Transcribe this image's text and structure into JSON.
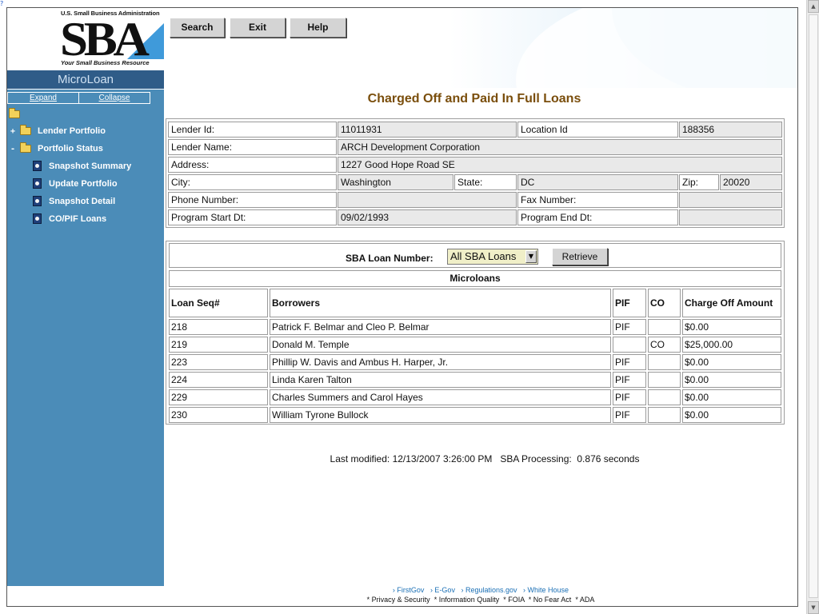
{
  "window": {
    "corner_icon": "help-icon"
  },
  "logo": {
    "top_text": "U.S. Small Business Administration",
    "letters": "SBA",
    "tagline": "Your Small Business Resource"
  },
  "sidebar": {
    "app_title": "MicroLoan",
    "expand_label": "Expand",
    "collapse_label": "Collapse",
    "tree": [
      {
        "label": "Lender Portfolio",
        "toggle": "+",
        "icon": "folder-closed-icon"
      },
      {
        "label": "Portfolio Status",
        "toggle": "-",
        "icon": "folder-open-icon"
      },
      {
        "label": "Snapshot Summary",
        "icon": "document-icon"
      },
      {
        "label": "Update Portfolio",
        "icon": "document-icon"
      },
      {
        "label": "Snapshot Detail",
        "icon": "document-icon"
      },
      {
        "label": "CO/PIF Loans",
        "icon": "document-icon"
      }
    ]
  },
  "toolbar": {
    "search_label": "Search",
    "exit_label": "Exit",
    "help_label": "Help"
  },
  "page": {
    "title": "Charged Off and Paid In Full Loans"
  },
  "lender": {
    "lender_id_label": "Lender Id:",
    "lender_id": "11011931",
    "location_id_label": "Location Id",
    "location_id": "188356",
    "lender_name_label": "Lender Name:",
    "lender_name": "ARCH Development Corporation",
    "address_label": "Address:",
    "address": "1227 Good Hope Road SE",
    "city_label": "City:",
    "city": "Washington",
    "state_label": "State:",
    "state": "DC",
    "zip_label": "Zip:",
    "zip": "20020",
    "phone_label": "Phone Number:",
    "phone": "",
    "fax_label": "Fax Number:",
    "fax": "",
    "program_start_label": "Program Start Dt:",
    "program_start": "09/02/1993",
    "program_end_label": "Program End Dt:",
    "program_end": ""
  },
  "loans": {
    "select_label": "SBA Loan Number:",
    "select_value": "All SBA Loans",
    "retrieve_label": "Retrieve",
    "section_title": "Microloans",
    "columns": [
      "Loan Seq#",
      "Borrowers",
      "PIF",
      "CO",
      "Charge Off Amount"
    ],
    "rows": [
      {
        "seq": "218",
        "borrowers": "Patrick F. Belmar and Cleo P. Belmar",
        "pif": "PIF",
        "co": "",
        "amount": "$0.00"
      },
      {
        "seq": "219",
        "borrowers": "Donald M. Temple",
        "pif": "",
        "co": "CO",
        "amount": "$25,000.00"
      },
      {
        "seq": "223",
        "borrowers": "Phillip W. Davis and Ambus H. Harper, Jr.",
        "pif": "PIF",
        "co": "",
        "amount": "$0.00"
      },
      {
        "seq": "224",
        "borrowers": "Linda Karen Talton",
        "pif": "PIF",
        "co": "",
        "amount": "$0.00"
      },
      {
        "seq": "229",
        "borrowers": "Charles Summers and Carol Hayes",
        "pif": "PIF",
        "co": "",
        "amount": "$0.00"
      },
      {
        "seq": "230",
        "borrowers": "William Tyrone Bullock",
        "pif": "PIF",
        "co": "",
        "amount": "$0.00"
      }
    ]
  },
  "footer": {
    "modified_text": "Last modified: 12/13/2007 3:26:00 PM   SBA Processing:  0.876 seconds",
    "links": [
      "› FirstGov",
      "› E-Gov",
      "› Regulations.gov",
      "› White House"
    ],
    "policies": [
      "* Privacy & Security",
      "* Information Quality",
      "* FOIA",
      "* No Fear Act",
      "* ADA"
    ]
  },
  "colors": {
    "sidebar_bg": "#4b8cb8",
    "app_title_bg": "#2f5c88",
    "title_color": "#7a4e0c",
    "value_cell_bg": "#e9e9e9",
    "link_color": "#1a6fb5"
  }
}
